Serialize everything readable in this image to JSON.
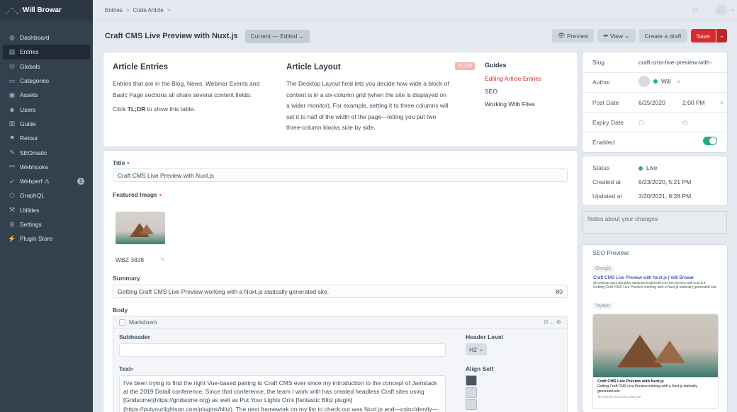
{
  "user": {
    "name": "Will Browar"
  },
  "nav": [
    {
      "label": "Dashboard",
      "icon": "dashboard-icon"
    },
    {
      "label": "Entries",
      "icon": "entries-icon",
      "active": true
    },
    {
      "label": "Globals",
      "icon": "globe-icon"
    },
    {
      "label": "Categories",
      "icon": "folder-icon"
    },
    {
      "label": "Assets",
      "icon": "image-icon"
    },
    {
      "label": "Users",
      "icon": "users-icon"
    },
    {
      "label": "Guide",
      "icon": "book-icon"
    },
    {
      "label": "Retour",
      "icon": "flag-icon"
    },
    {
      "label": "SEOmatic",
      "icon": "seo-icon"
    },
    {
      "label": "Webhooks",
      "icon": "webhook-icon"
    },
    {
      "label": "Webperf ⚠",
      "icon": "rocket-icon",
      "badge": "1"
    },
    {
      "label": "GraphQL",
      "icon": "graphql-icon"
    },
    {
      "label": "Utilities",
      "icon": "wrench-icon"
    },
    {
      "label": "Settings",
      "icon": "gear-icon"
    },
    {
      "label": "Plugin Store",
      "icon": "plug-icon"
    }
  ],
  "breadcrumb": {
    "root": "Entries",
    "section": "Code Article",
    "sep": ">"
  },
  "page": {
    "title": "Craft CMS Live Preview with Nuxt.js",
    "draft_status": "Current — Edited"
  },
  "actions": {
    "preview": "Preview",
    "view": "View",
    "create_draft": "Create a draft",
    "save": "Save"
  },
  "guide": {
    "entries_title": "Article Entries",
    "entries_p1": "Entries that are in the Blog, News, Webinar Events and Basic Page sections all share several content fields:",
    "entries_p2_pre": "Click ",
    "entries_p2_bold": "TL;DR",
    "entries_p2_post": " to show this table.",
    "layout_title": "Article Layout",
    "layout_p": "The Desktop Layout field lets you decide how wide a block of content is in a six-column grid (when the site is displayed on a wider monitor). For example, setting it to three columns will set it to half of the width of the page—letting you put two three-column blocks side by side.",
    "tldr": "TL;DR",
    "guides_title": "Guides",
    "guides": [
      "Editing Article Entries",
      "SEO",
      "Working With Files"
    ]
  },
  "fields": {
    "title_label": "Title",
    "title_value": "Craft CMS Live Preview with Nuxt.js",
    "image_label": "Featured Image",
    "asset_name": "WBZ 3828",
    "summary_label": "Summary",
    "summary_value": "Getting Craft CMS Live Preview working with a Nuxt.js statically generated site.",
    "summary_count": "80",
    "body_label": "Body",
    "block_type": "Markdown",
    "subheader_label": "Subheader",
    "header_level_label": "Header Level",
    "header_level_value": "H2",
    "text_label": "Text",
    "text_value": "I've been trying to find the right Vue-based pairing to Craft CMS ever since my introduction to the concept of Jamstack at the 2019 Dotall conference. Since that conference, the team I work with has created headless Craft sites using [Gridsome](https://gridsome.org) as well as Put Your Lights On's [fantastic Blitz plugin](https://putyourlightson.com/plugins/blitz). The next framework on my list to check out was Nuxt.js and—coincidently—",
    "align_self_label": "Align Self"
  },
  "meta": {
    "slug_label": "Slug",
    "slug_value": "craft-cms-live-preview-with-",
    "author_label": "Author",
    "author_value": "Will",
    "post_date_label": "Post Date",
    "post_date": "6/25/2020",
    "post_time": "2:00 PM",
    "expiry_label": "Expiry Date",
    "enabled_label": "Enabled"
  },
  "status": {
    "status_label": "Status",
    "status_value": "Live",
    "created_label": "Created at",
    "created_value": "6/23/2020, 5:21 PM",
    "updated_label": "Updated at",
    "updated_value": "3/20/2021, 8:28 PM"
  },
  "notes_placeholder": "Notes about your changes",
  "seo": {
    "label": "SEO Preview:",
    "google_tag": "Google",
    "google_title": "Craft CMS Live Preview with Nuxt.js | Will Browar",
    "google_url": "wb-website-2021-dist.ddev.site/article/code/craft-cms-live-preview-with-nuxt-js ▾",
    "google_desc": "Getting Craft CMS Live Preview working with a Nuxt.js statically generated site.",
    "twitter_tag": "Twitter",
    "tw_title": "Craft CMS Live Preview with Nuxt.js",
    "tw_desc": "Getting Craft CMS Live Preview working with a Nuxt.js statically generated site.",
    "tw_url": "wb-website-2021-dist.ddev.site"
  },
  "colors": {
    "accent": "#da2c2c",
    "sidebar": "#33404d",
    "enabled": "#27ab83"
  }
}
